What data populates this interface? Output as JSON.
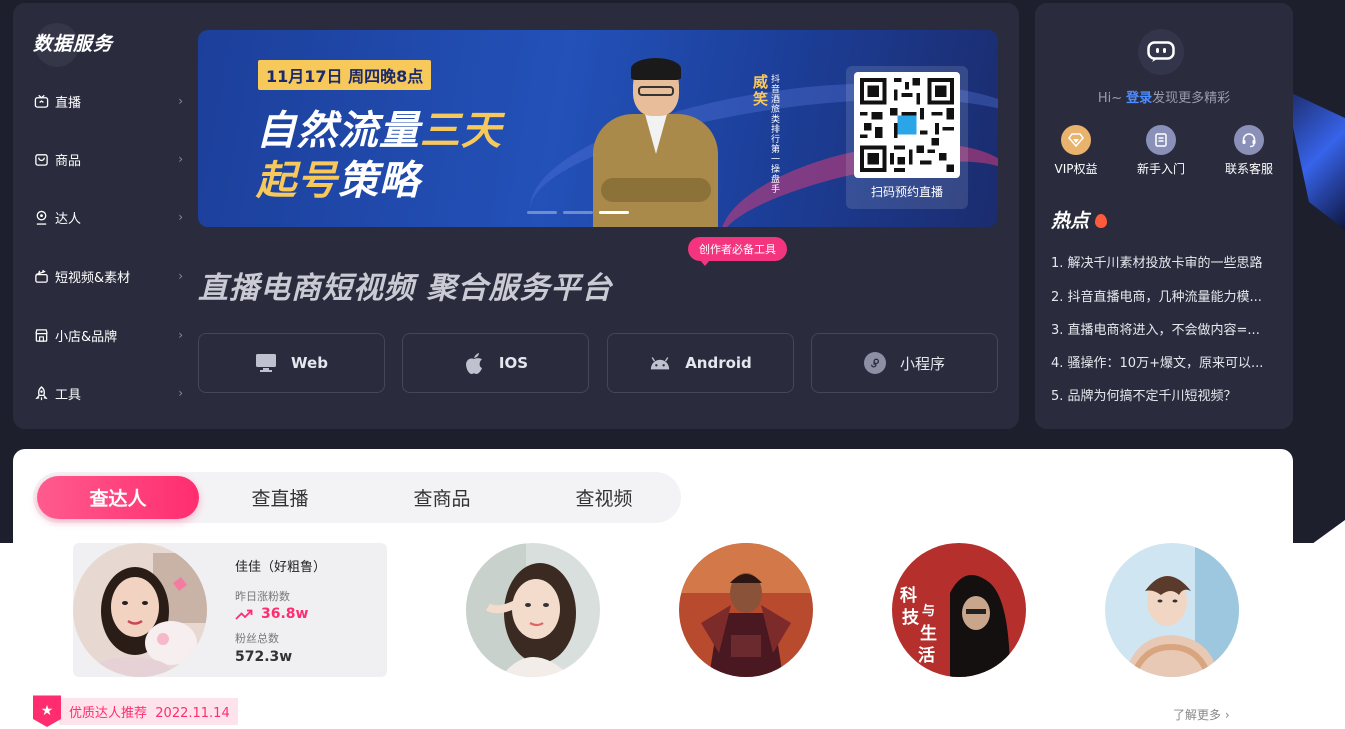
{
  "sidebar": {
    "title": "数据服务",
    "items": [
      {
        "label": "直播",
        "icon": "live-tv-icon"
      },
      {
        "label": "商品",
        "icon": "shopping-bag-icon"
      },
      {
        "label": "达人",
        "icon": "user-badge-icon"
      },
      {
        "label": "短视频&素材",
        "icon": "video-clapper-icon"
      },
      {
        "label": "小店&品牌",
        "icon": "store-icon"
      },
      {
        "label": "工具",
        "icon": "rocket-icon"
      }
    ]
  },
  "banner": {
    "date": "11月17日 周四晚8点",
    "title1_a": "自然流量",
    "title1_b": "三天",
    "title2_a": "起号",
    "title2_b": "策略",
    "speaker_name": "威笑",
    "speaker_role": "抖音酒旅类排行第一操盘手",
    "qr_caption": "扫码预约直播"
  },
  "slogan": {
    "tag": "创作者必备工具",
    "text": "直播电商短视频  聚合服务平台"
  },
  "platforms": [
    {
      "label": "Web",
      "icon": "monitor-icon"
    },
    {
      "label": "IOS",
      "icon": "apple-icon"
    },
    {
      "label": "Android",
      "icon": "android-icon"
    },
    {
      "label": "小程序",
      "icon": "mini-program-icon"
    }
  ],
  "user_panel": {
    "greeting": "Hi~",
    "login": "登录",
    "prompt": "发现更多精彩",
    "links": [
      {
        "label": "VIP权益",
        "icon": "vip-diamond-icon",
        "color": "#e9b26d"
      },
      {
        "label": "新手入门",
        "icon": "guide-book-icon",
        "color": "#8b90b8"
      },
      {
        "label": "联系客服",
        "icon": "headset-icon",
        "color": "#8b90b8"
      }
    ]
  },
  "hot": {
    "title": "热点",
    "items": [
      "1. 解决千川素材投放卡审的一些思路",
      "2. 抖音直播电商，几种流量能力模...",
      "3. 直播电商将进入，不会做内容=...",
      "4. 骚操作：10万+爆文，原来可以...",
      "5. 品牌为何搞不定千川短视频？"
    ]
  },
  "search_tabs": [
    "查达人",
    "查直播",
    "查商品",
    "查视频"
  ],
  "active_tab": "查达人",
  "featured": {
    "name": "佳佳（好粗鲁）",
    "growth_label": "昨日涨粉数",
    "growth_value": "36.8w",
    "total_label": "粉丝总数",
    "total_value": "572.3w"
  },
  "recommend": {
    "label": "优质达人推荐",
    "date": "2022.11.14",
    "more": "了解更多"
  },
  "colors": {
    "brand_pink": "#ff2d6f",
    "login_blue": "#4d8dff",
    "banner_gold": "#f7c85a",
    "panel_bg": "#2a2c3d"
  }
}
